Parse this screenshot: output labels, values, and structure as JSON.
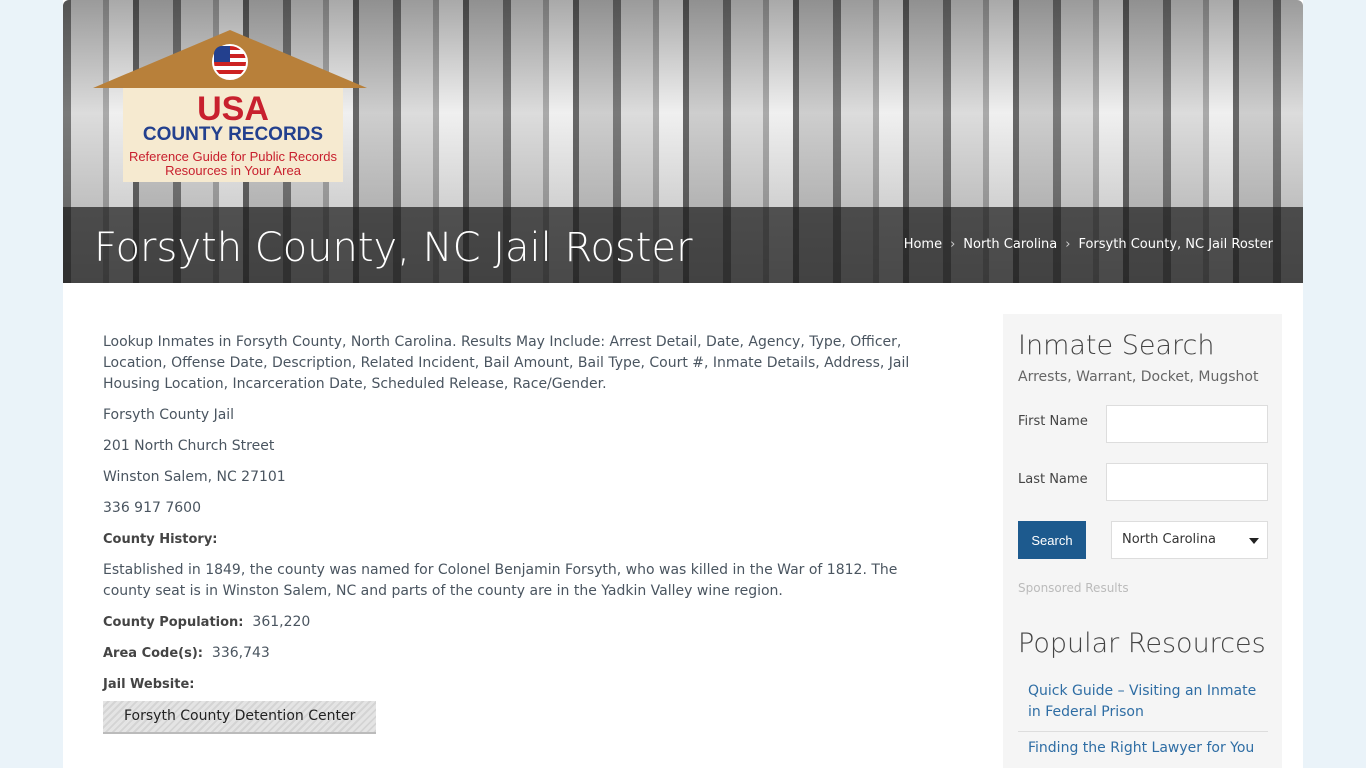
{
  "logo": {
    "line1": "USA",
    "line2": "COUNTY RECORDS",
    "line3": "Reference Guide for Public Records Resources in Your Area"
  },
  "header": {
    "title": "Forsyth County, NC Jail Roster",
    "breadcrumbs": [
      "Home",
      "North Carolina",
      "Forsyth County, NC Jail Roster"
    ]
  },
  "main": {
    "intro": "Lookup Inmates in Forsyth County, North Carolina. Results May Include: Arrest Detail, Date, Agency, Type, Officer, Location, Offense Date, Description, Related Incident, Bail Amount, Bail Type, Court #, Inmate Details, Address, Jail Housing Location, Incarceration Date, Scheduled Release, Race/Gender.",
    "jail_name": "Forsyth County Jail",
    "street": "201 North Church Street",
    "city": "Winston Salem, NC  27101",
    "phone": "336 917 7600",
    "history_label": "County History:",
    "history": "Established in 1849, the county was named for Colonel Benjamin Forsyth, who was killed in the War of 1812.  The county seat is in Winston Salem, NC and parts of the county are in the Yadkin Valley wine region.",
    "population_label": "County Population:",
    "population": "361,220",
    "area_label": "Area Code(s):",
    "area_codes": "336,743",
    "website_label": "Jail Website:",
    "website_button": "Forsyth County Detention Center"
  },
  "sidebar": {
    "title": "Inmate Search",
    "subtitle": "Arrests, Warrant, Docket, Mugshot",
    "first_name": "First Name",
    "last_name": "Last Name",
    "search": "Search",
    "state": "North Carolina",
    "sponsored": "Sponsored Results",
    "resources_title": "Popular Resources",
    "resources": [
      "Quick Guide – Visiting an Inmate in Federal Prison",
      "Finding the Right Lawyer for You"
    ]
  }
}
